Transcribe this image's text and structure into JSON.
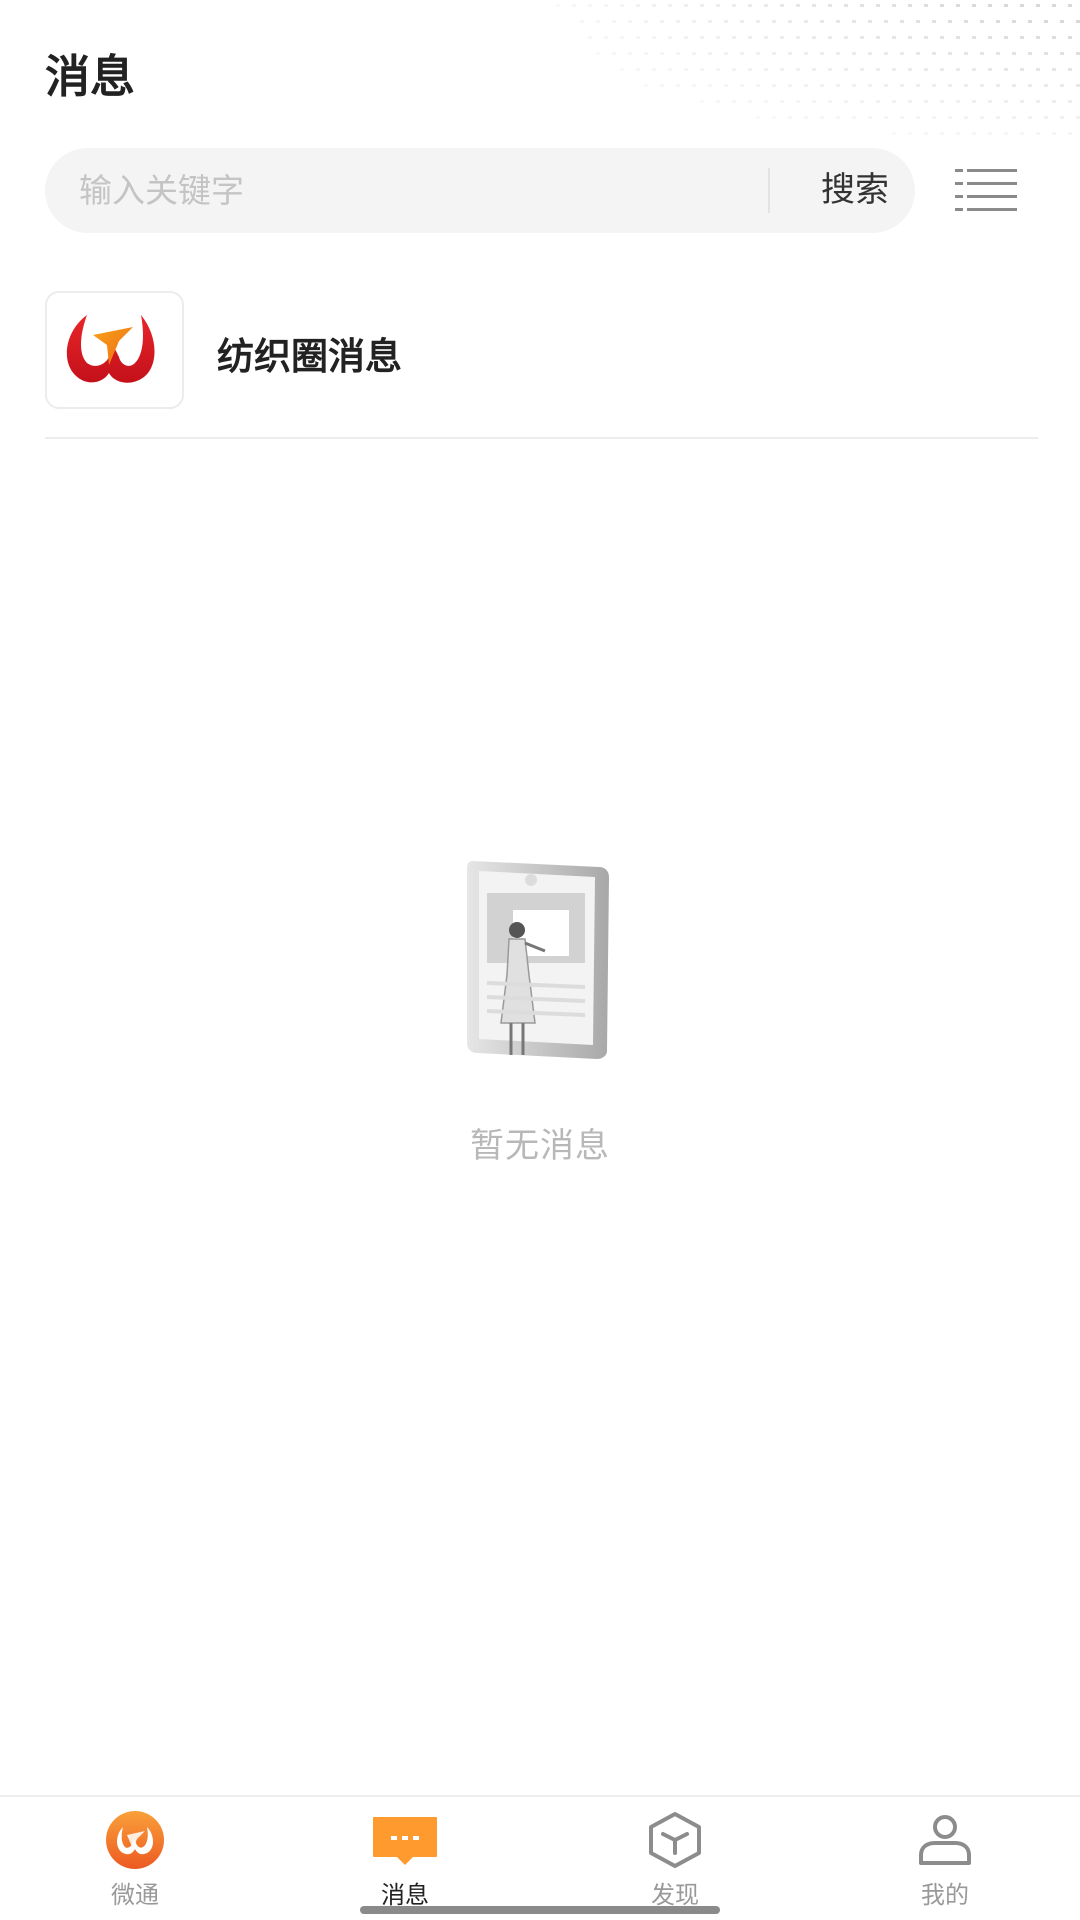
{
  "header": {
    "title": "消息"
  },
  "search": {
    "placeholder": "输入关键字",
    "value": "",
    "button_label": "搜索"
  },
  "message_list": [
    {
      "title": "纺织圈消息",
      "icon": "app-logo-icon"
    }
  ],
  "empty_state": {
    "text": "暂无消息",
    "icon": "empty-phone-illustration"
  },
  "tabbar": {
    "active_index": 1,
    "accent_color": "#ff9a2e",
    "tabs": [
      {
        "label": "微通",
        "icon": "app-logo-icon"
      },
      {
        "label": "消息",
        "icon": "chat-bubble-icon"
      },
      {
        "label": "发现",
        "icon": "cube-icon"
      },
      {
        "label": "我的",
        "icon": "person-icon"
      }
    ]
  }
}
